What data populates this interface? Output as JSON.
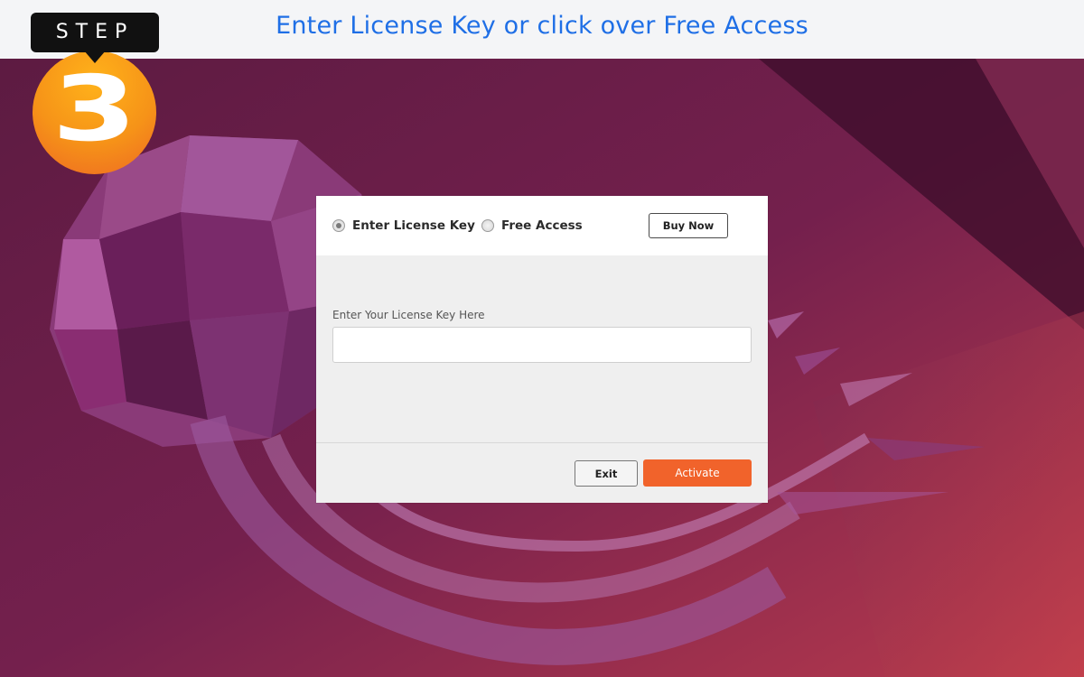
{
  "banner": {
    "title": "Enter License Key or click over Free Access"
  },
  "step_badge": {
    "label": "STEP",
    "number": "3"
  },
  "dialog": {
    "options": [
      {
        "label": "Enter License Key",
        "checked": true
      },
      {
        "label": "Free Access",
        "checked": false
      }
    ],
    "buy_now_label": "Buy Now",
    "field_label": "Enter Your License Key Here",
    "license_key_value": "",
    "exit_label": "Exit",
    "activate_label": "Activate"
  },
  "colors": {
    "banner_title": "#1f6fe6",
    "activate_button": "#f1632b",
    "badge_orange": "#f69318",
    "background_purple": "#6a1f48"
  },
  "icons": {
    "background": "ubuntu-jellyfish-wallpaper"
  }
}
